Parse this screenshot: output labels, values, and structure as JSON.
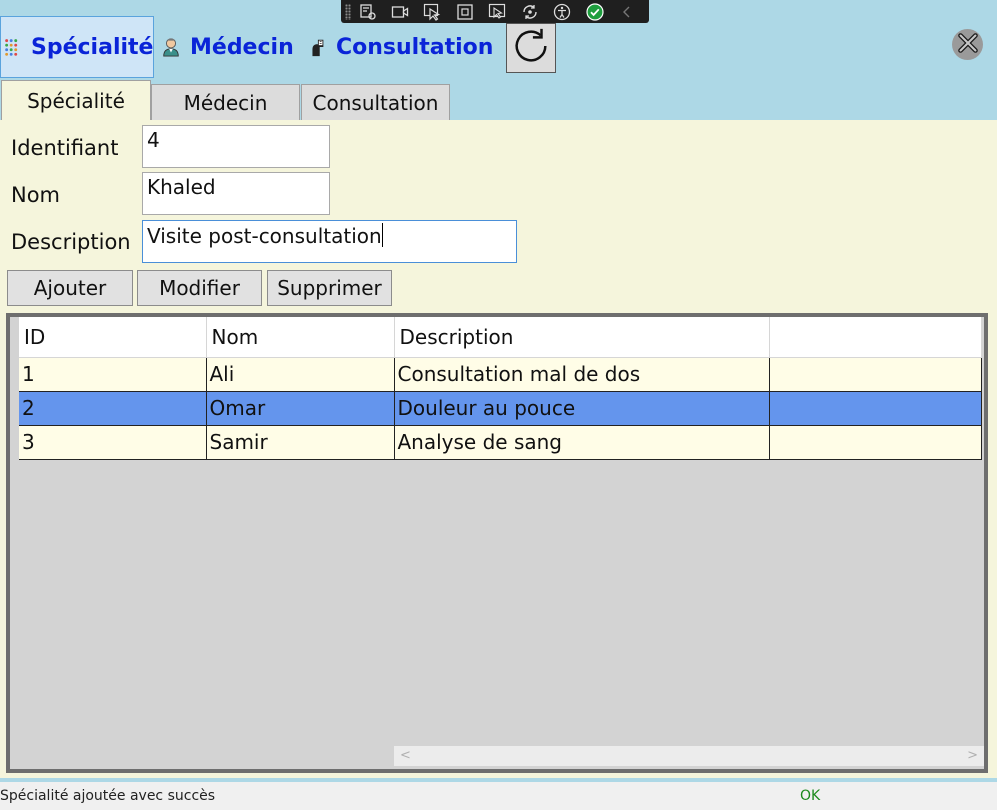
{
  "devbar": {
    "icons": [
      "select-element-icon",
      "video-icon",
      "pointer-select-icon",
      "layout-adorner-icon",
      "display-layout-icon",
      "hot-reload-icon",
      "accessibility-icon",
      "checkmark-icon",
      "collapse-chevron-icon"
    ]
  },
  "menu": {
    "specialite": "Spécialité",
    "medecin": "Médecin",
    "consultation": "Consultation"
  },
  "tabs": [
    {
      "label": "Spécialité",
      "active": true
    },
    {
      "label": "Médecin",
      "active": false
    },
    {
      "label": "Consultation",
      "active": false
    }
  ],
  "form": {
    "identifiant_label": "Identifiant",
    "identifiant_value": "4",
    "nom_label": "Nom",
    "nom_value": "Khaled",
    "description_label": "Description",
    "description_value": "Visite post-consultation"
  },
  "buttons": {
    "ajouter": "Ajouter",
    "modifier": "Modifier",
    "supprimer": "Supprimer"
  },
  "grid": {
    "columns": [
      "ID",
      "Nom",
      "Description",
      ""
    ],
    "rows": [
      {
        "id": "1",
        "nom": "Ali",
        "description": "Consultation mal de dos",
        "selected": false
      },
      {
        "id": "2",
        "nom": "Omar",
        "description": "Douleur au pouce",
        "selected": true
      },
      {
        "id": "3",
        "nom": "Samir",
        "description": "Analyse de sang",
        "selected": false
      }
    ]
  },
  "status": {
    "message": "Spécialité ajoutée avec succès",
    "state": "OK"
  },
  "colors": {
    "window_bg": "#add8e6",
    "content_bg": "#f5f5dc",
    "selected_row": "#6495ed",
    "menu_text": "#0a24d8",
    "status_ok": "#1b8a1b"
  }
}
